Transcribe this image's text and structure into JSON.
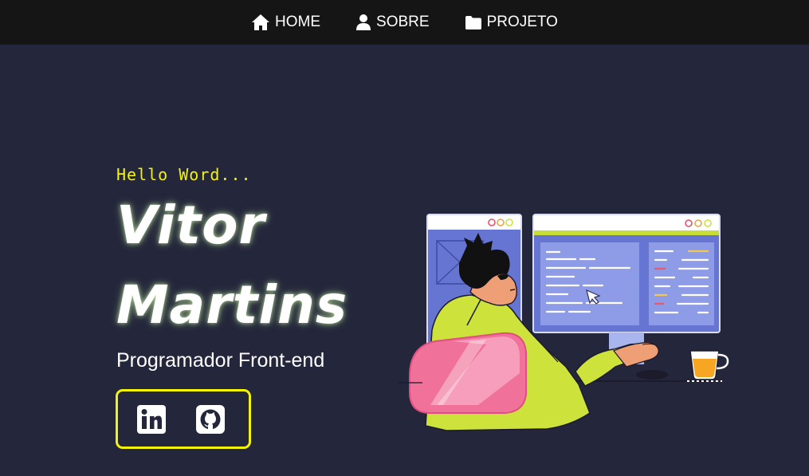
{
  "nav": {
    "items": [
      {
        "label": "HOME",
        "icon": "home-icon"
      },
      {
        "label": "SOBRE",
        "icon": "user-icon"
      },
      {
        "label": "PROJETO",
        "icon": "folder-icon"
      }
    ]
  },
  "hero": {
    "greeting": "Hello Word...",
    "first_name": "Vitor",
    "last_name": "Martins",
    "role": "Programador Front-end"
  },
  "social": {
    "links": [
      {
        "icon": "linkedin-icon"
      },
      {
        "icon": "github-icon"
      }
    ]
  },
  "illustration": {
    "subject": "developer-at-computer-illustration"
  },
  "colors": {
    "background": "#24263b",
    "navbar": "#151515",
    "accent": "#f5f20a",
    "text": "#ffffff"
  }
}
